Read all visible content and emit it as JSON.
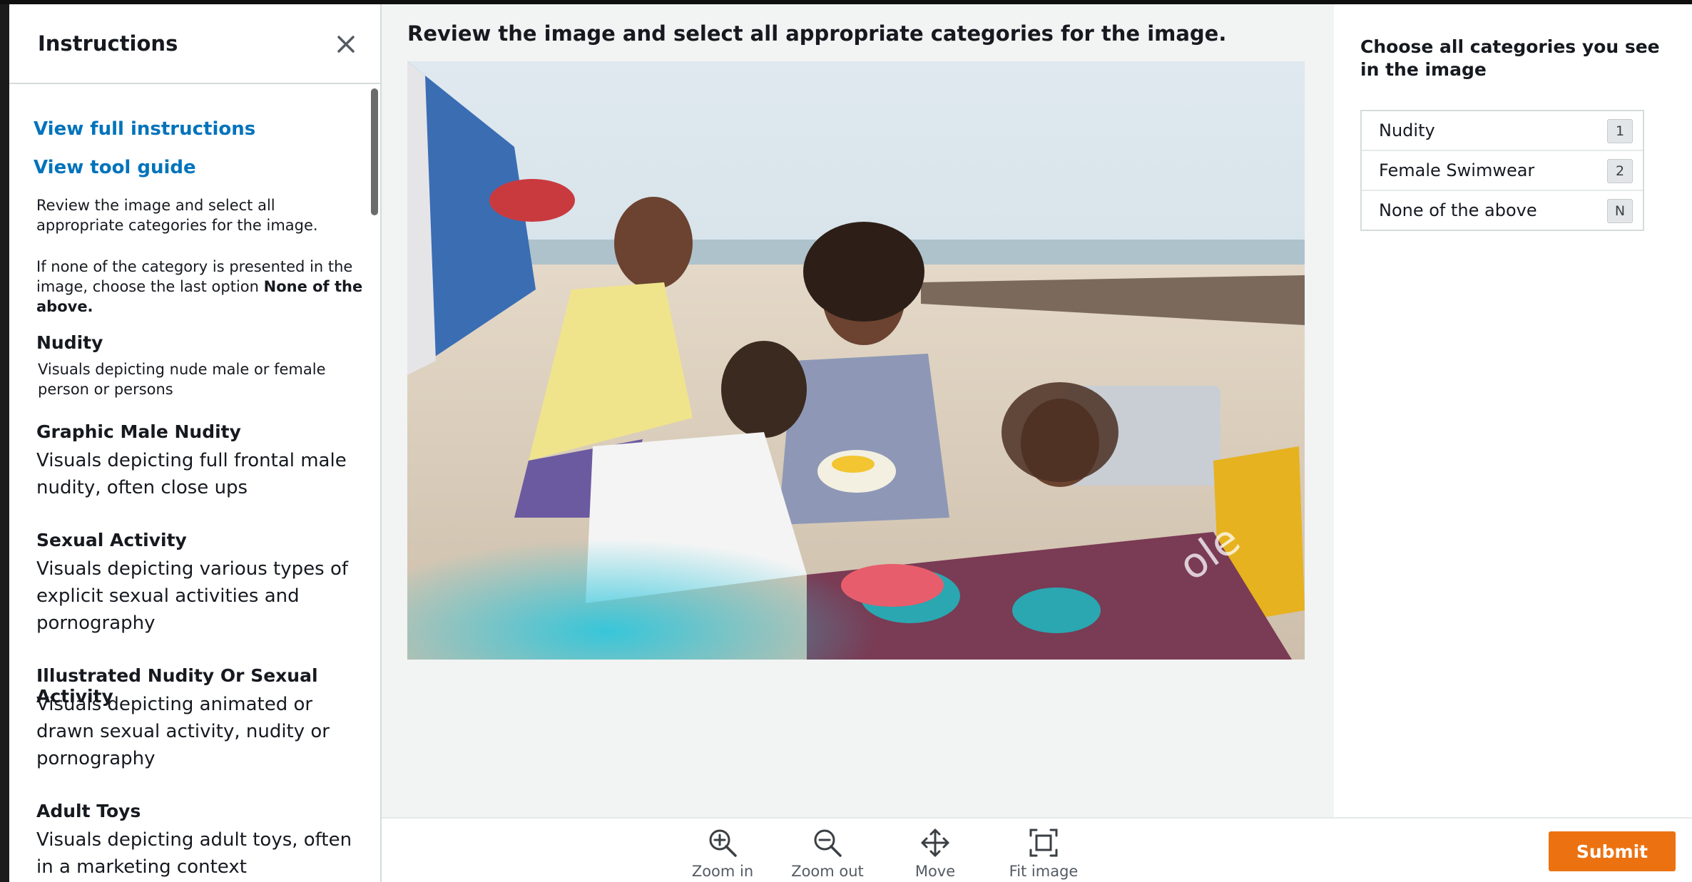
{
  "instructions_panel": {
    "title": "Instructions",
    "links": {
      "full_instructions": "View full instructions",
      "tool_guide": "View tool guide"
    },
    "intro": "Review the image and select all appropriate categories for the image.",
    "none_note_prefix": "If none of the category is presented in the image, choose the last option ",
    "none_note_bold": "None of the above.",
    "categories": [
      {
        "title": "Nudity",
        "description": "Visuals depicting nude male or female person or persons"
      },
      {
        "title": "Graphic Male Nudity",
        "description": "Visuals depicting full frontal male nudity, often close ups"
      },
      {
        "title": "Sexual Activity",
        "description": "Visuals depicting various types of explicit sexual activities and pornography"
      },
      {
        "title": "Illustrated Nudity Or Sexual Activity",
        "description": "Visuals depicting animated or drawn sexual activity, nudity or pornography"
      },
      {
        "title": "Adult Toys",
        "description": "Visuals depicting adult toys, often in a marketing context"
      }
    ]
  },
  "main": {
    "prompt": "Review the image and select all appropriate categories for the image.",
    "image_watermark": "ole"
  },
  "toolbar": {
    "zoom_in": "Zoom in",
    "zoom_out": "Zoom out",
    "move": "Move",
    "fit_image": "Fit image"
  },
  "categories_panel": {
    "title": "Choose all categories you see in the image",
    "options": [
      {
        "label": "Nudity",
        "key": "1"
      },
      {
        "label": "Female Swimwear",
        "key": "2"
      },
      {
        "label": "None of the above",
        "key": "N"
      }
    ]
  },
  "submit_label": "Submit",
  "colors": {
    "accent": "#ec7211",
    "link": "#0073bb",
    "background": "#f2f3f3"
  }
}
